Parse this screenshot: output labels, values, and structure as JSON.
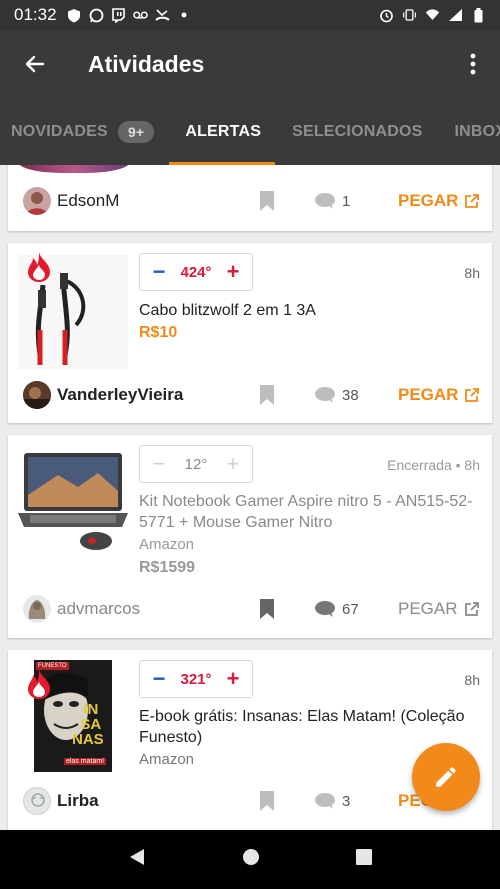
{
  "status": {
    "time": "01:32",
    "left_icons": [
      "shield-icon",
      "whatsapp-icon",
      "twitch-icon",
      "voicemail-icon",
      "missed-call-icon",
      "dot-icon"
    ],
    "right_icons": [
      "alarm-icon",
      "vibrate-icon",
      "wifi-icon",
      "signal-icon",
      "battery-icon"
    ]
  },
  "appbar": {
    "title": "Atividades"
  },
  "tabs": [
    {
      "label": "NOVIDADES",
      "badge": "9+"
    },
    {
      "label": "ALERTAS",
      "active": true
    },
    {
      "label": "SELECIONADOS"
    },
    {
      "label": "INBOX"
    }
  ],
  "cards": [
    {
      "user": "EdsonM",
      "comments": "1",
      "action": "PEGAR"
    },
    {
      "temperature": "424°",
      "time": "8h",
      "title": "Cabo blitzwolf 2 em 1 3A",
      "price": "R$10",
      "user": "VanderleyVieira",
      "comments": "38",
      "action": "PEGAR"
    },
    {
      "temperature": "12°",
      "time": "Encerrada • 8h",
      "title": "Kit Notebook Gamer Aspire nitro 5 - AN515-52-5771 + Mouse Gamer Nitro",
      "merchant": "Amazon",
      "price": "R$1599",
      "user": "advmarcos",
      "comments": "67",
      "action": "PEGAR"
    },
    {
      "temperature": "321°",
      "time": "8h",
      "title": "E-book grátis: Insanas: Elas Matam! (Coleção Funesto)",
      "merchant": "Amazon",
      "user": "Lirba",
      "comments": "3",
      "action": "PEGAR",
      "cover_text": [
        "FUNESTO",
        "IN",
        "SA",
        "NAS",
        "elas matam!"
      ]
    }
  ],
  "colors": {
    "accent": "#f28a1b",
    "hot_red": "#d91b3a",
    "cold_blue": "#1e5cc0",
    "appbar": "#3a3a3a"
  }
}
